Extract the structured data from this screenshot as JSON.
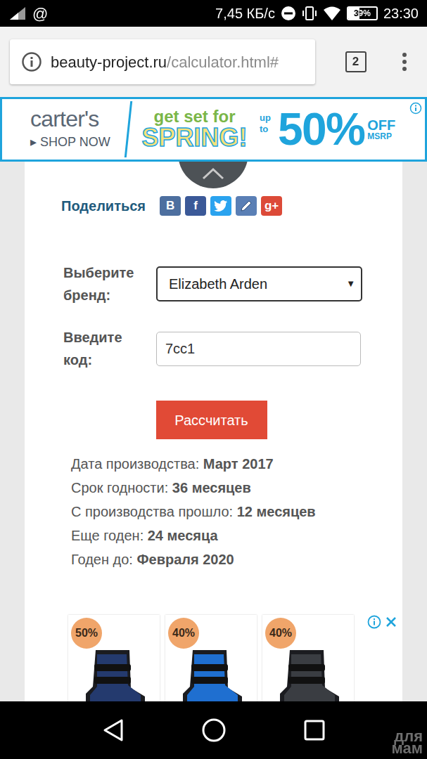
{
  "status_bar": {
    "at_sign": "@",
    "speed": "7,45 КБ/с",
    "battery": "39%",
    "battery_level": 0.39,
    "time": "23:30"
  },
  "browser": {
    "domain": "beauty-project.ru",
    "path": "/calculator.html#",
    "tab_count": "2"
  },
  "top_ad": {
    "brand": "carter's",
    "cta": "▸ SHOP NOW",
    "headline": "get set for",
    "highlight": "SPRING!",
    "prefix": "up to",
    "discount": "50%",
    "off": "OFF",
    "note": "MSRP"
  },
  "share": {
    "label": "Поделиться",
    "buttons": [
      {
        "kind": "text",
        "label": "В",
        "color": "#4d6f9f"
      },
      {
        "kind": "text",
        "label": "f",
        "color": "#3b5998"
      },
      {
        "kind": "twitter",
        "color": "#2aa3ef"
      },
      {
        "kind": "edit",
        "color": "#5a7fb5"
      },
      {
        "kind": "text",
        "label": "g+",
        "color": "#dc4a38"
      }
    ]
  },
  "form": {
    "brand_label": "Выберите бренд:",
    "brand_value": "Elizabeth Arden",
    "dropdown_arrow": "▼",
    "code_label": "Введите код:",
    "code_value": "7cc1",
    "button": "Рассчитать"
  },
  "results": [
    {
      "label": "Дата производства:",
      "value": "Март 2017"
    },
    {
      "label": "Срок годности:",
      "value": "36 месяцев"
    },
    {
      "label": "С производства прошло:",
      "value": "12 месяцев"
    },
    {
      "label": "Еще годен:",
      "value": "24 месяца"
    },
    {
      "label": "Годен до:",
      "value": "Февраля 2020"
    }
  ],
  "bottom_ad": {
    "items": [
      {
        "badge": "50%",
        "color": "#243a6e"
      },
      {
        "badge": "40%",
        "color": "#1f6fd0"
      },
      {
        "badge": "40%",
        "color": "#3a3d42"
      }
    ]
  },
  "watermark": "для мам"
}
